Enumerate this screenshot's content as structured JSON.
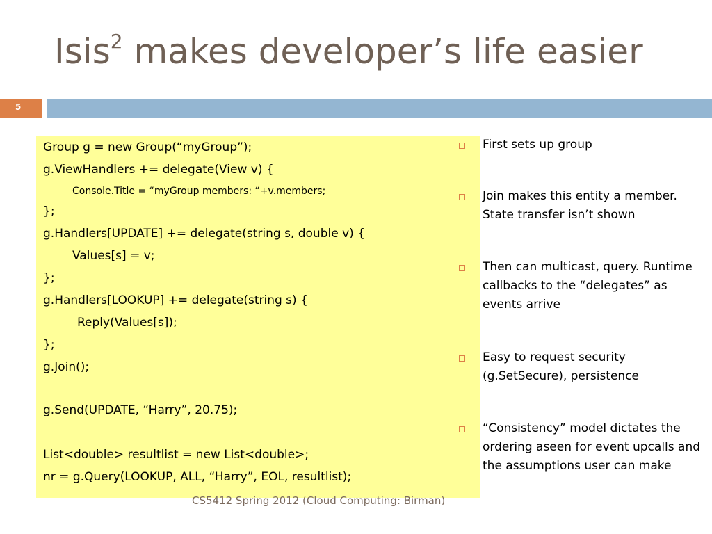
{
  "slide": {
    "title_main": "Isis",
    "title_sup": "2",
    "title_rest": " makes developer’s life easier",
    "number": "5",
    "footer": "CS5412 Spring 2012 (Cloud Computing: Birman)"
  },
  "code": [
    "Group g = new Group(“myGroup”);",
    "g.ViewHandlers += delegate(View v) {",
    "Console.Title = “myGroup members: “+v.members;",
    "};",
    "g.Handlers[UPDATE] += delegate(string s, double v) {",
    "Values[s] = v;",
    "};",
    "g.Handlers[LOOKUP] += delegate(string s) {",
    "Reply(Values[s]);",
    "};",
    "g.Join();",
    "g.Send(UPDATE, “Harry”, 20.75);",
    "List<double> resultlist = new List<double>;",
    "nr = g.Query(LOOKUP, ALL, “Harry”, EOL, resultlist);"
  ],
  "bullets": [
    "First sets up group",
    "Join makes this entity a member. State transfer isn’t shown",
    "Then can multicast, query. Runtime callbacks to the “delegates” as events arrive",
    "Easy to request security (g.SetSecure), persistence",
    "“Consistency” model dictates the ordering aseen for event upcalls and the assumptions user can make"
  ],
  "colors": {
    "title": "#6f6055",
    "accent_orange": "#dd8047",
    "accent_blue": "#94b6d2",
    "code_background": "#ffff99"
  }
}
